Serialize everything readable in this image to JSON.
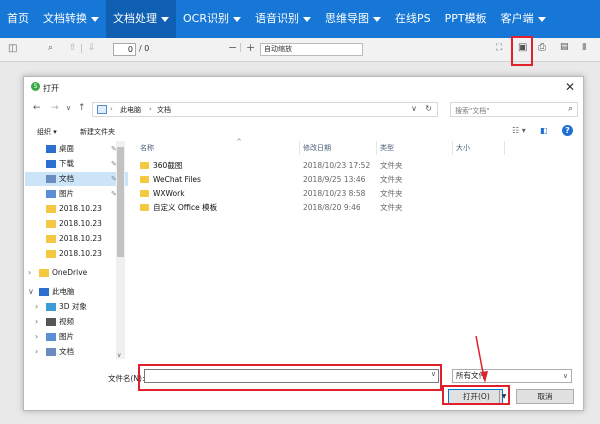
{
  "topnav": {
    "items": [
      {
        "label": "首页",
        "caret": false
      },
      {
        "label": "文档转换",
        "caret": true
      },
      {
        "label": "文档处理",
        "caret": true
      },
      {
        "label": "OCR识别",
        "caret": true
      },
      {
        "label": "语音识别",
        "caret": true
      },
      {
        "label": "思维导图",
        "caret": true
      },
      {
        "label": "在线PS",
        "caret": false
      },
      {
        "label": "PPT模板",
        "caret": false
      },
      {
        "label": "客户端",
        "caret": true
      }
    ]
  },
  "viewer": {
    "page_value": "0",
    "page_total": "/ 0",
    "zoom_value": "自动缩放"
  },
  "dialog": {
    "title": "打开",
    "breadcrumb": [
      "此电脑",
      "文档"
    ],
    "search_placeholder": "搜索\"文档\"",
    "organize": "组织 ▾",
    "new_folder": "新建文件夹",
    "nav": [
      {
        "label": "桌面",
        "icon": "desktop-icon",
        "pinned": true,
        "indent": 1
      },
      {
        "label": "下载",
        "icon": "download-icon",
        "pinned": true,
        "indent": 1
      },
      {
        "label": "文档",
        "icon": "documents-icon",
        "pinned": true,
        "indent": 1,
        "selected": true
      },
      {
        "label": "图片",
        "icon": "pictures-icon",
        "pinned": true,
        "indent": 1
      },
      {
        "label": "2018.10.23",
        "icon": "folder-icon",
        "indent": 1
      },
      {
        "label": "2018.10.23",
        "icon": "folder-icon",
        "indent": 1
      },
      {
        "label": "2018.10.23",
        "icon": "folder-icon",
        "indent": 1
      },
      {
        "label": "2018.10.23",
        "icon": "folder-icon",
        "indent": 1
      },
      {
        "label": "OneDrive",
        "icon": "folder-icon",
        "chevron": true,
        "indent": 1
      },
      {
        "label": "此电脑",
        "icon": "computer-icon",
        "chevron": true,
        "expanded": true,
        "indent": 1
      },
      {
        "label": "3D 对象",
        "icon": "3d-objects-icon",
        "chevron": true,
        "indent": 2
      },
      {
        "label": "视频",
        "icon": "video-icon",
        "chevron": true,
        "indent": 2
      },
      {
        "label": "图片",
        "icon": "pictures-icon",
        "chevron": true,
        "indent": 2
      },
      {
        "label": "文档",
        "icon": "documents-icon",
        "chevron": true,
        "indent": 2
      }
    ],
    "columns": {
      "name": "名称",
      "date": "修改日期",
      "type": "类型",
      "size": "大小"
    },
    "files": [
      {
        "name": "360截图",
        "date": "2018/10/23 17:52",
        "type": "文件夹"
      },
      {
        "name": "WeChat Files",
        "date": "2018/9/25 13:46",
        "type": "文件夹"
      },
      {
        "name": "WXWork",
        "date": "2018/10/23 8:58",
        "type": "文件夹"
      },
      {
        "name": "自定义 Office 模板",
        "date": "2018/8/20 9:46",
        "type": "文件夹"
      }
    ],
    "filename_label": "文件名(N):",
    "filename_value": "",
    "filetype_value": "所有文件",
    "open_button": "打开(O)",
    "cancel_button": "取消"
  },
  "colors": {
    "nav_bg": "#1677d6",
    "nav_active": "#0f5fb2",
    "highlight": "#e0202a",
    "accent": "#0078d7"
  }
}
